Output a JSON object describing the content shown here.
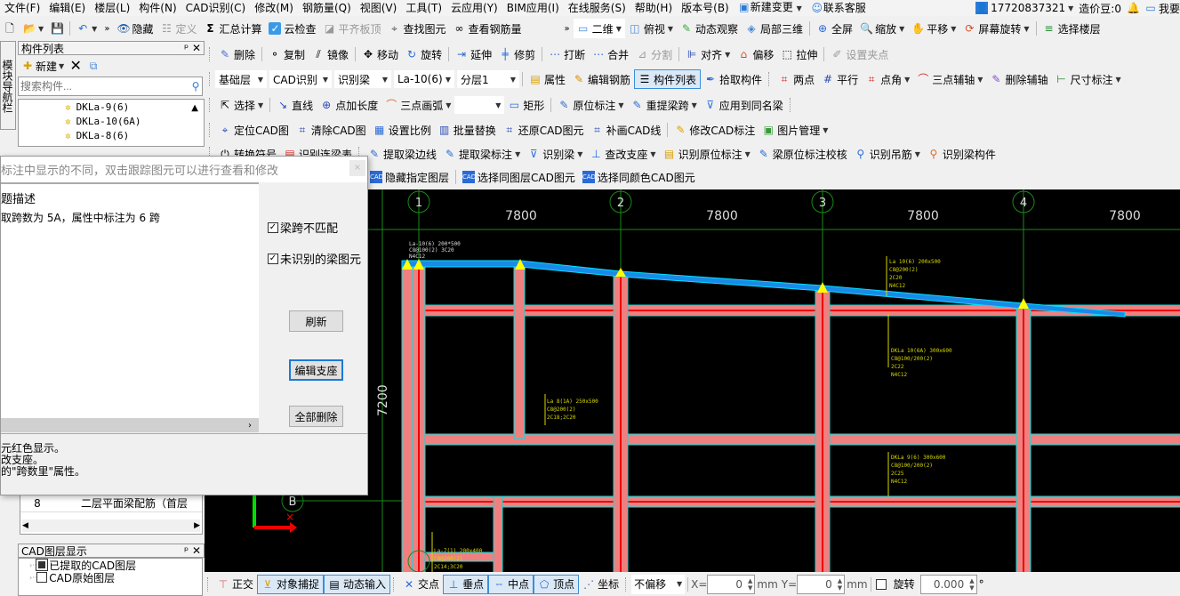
{
  "menu": {
    "items": [
      "文件(F)",
      "编辑(E)",
      "楼层(L)",
      "构件(N)",
      "CAD识别(C)",
      "修改(M)",
      "钢筋量(Q)",
      "视图(V)",
      "工具(T)",
      "云应用(Y)",
      "BIM应用(I)",
      "在线服务(S)",
      "帮助(H)",
      "版本号(B)"
    ],
    "new_change": "新建变更",
    "contact": "联系客服",
    "account": "17720837321",
    "beans": "造价豆:0",
    "find_me": "我要"
  },
  "toolbar1": {
    "hide": "隐藏",
    "define": "定义",
    "calc": "汇总计算",
    "cloud_check": "云检查",
    "level_slab": "平齐板顶",
    "find_elem": "查找图元",
    "view_rebar": "查看钢筋量",
    "view2d": "二维",
    "top_view": "俯视",
    "dyn_view": "动态观察",
    "local3d": "局部三维",
    "fullscreen": "全屏",
    "zoom": "缩放",
    "pan": "平移",
    "rotate_screen": "屏幕旋转",
    "select_floor": "选择楼层"
  },
  "left_panel": {
    "title": "构件列表",
    "new": "新建",
    "search_placeholder": "搜索构件...",
    "side_tab": "模块导航栏",
    "items": [
      "DKLa-9(6)",
      "DKLa-10(6A)",
      "DKLa-8(6)"
    ]
  },
  "toolbar2": {
    "delete": "删除",
    "copy": "复制",
    "mirror": "镜像",
    "move": "移动",
    "rotate": "旋转",
    "extend": "延伸",
    "trim": "修剪",
    "break": "打断",
    "merge": "合并",
    "split": "分割",
    "align": "对齐",
    "offset": "偏移",
    "stretch": "拉伸",
    "set_grip": "设置夹点"
  },
  "toolbar3": {
    "floor": "基础层",
    "mode": "CAD识别",
    "type": "识别梁",
    "component": "La-10(6)",
    "layer": "分层1",
    "property": "属性",
    "edit_rebar": "编辑钢筋",
    "comp_list": "构件列表",
    "pick": "拾取构件",
    "two_point": "两点",
    "parallel": "平行",
    "point_angle": "点角",
    "three_axis": "三点辅轴",
    "del_axis": "删除辅轴",
    "dimension": "尺寸标注"
  },
  "toolbar4": {
    "select": "选择",
    "line": "直线",
    "point_len": "点加长度",
    "arc": "三点画弧",
    "rect": "矩形",
    "orig_mark": "原位标注",
    "redo_span": "重提梁跨",
    "apply_same": "应用到同名梁"
  },
  "toolbar5": {
    "locate": "定位CAD图",
    "clear": "清除CAD图",
    "scale": "设置比例",
    "batch": "批量替换",
    "restore": "还原CAD图元",
    "supplement": "补画CAD线",
    "modify_mark": "修改CAD标注",
    "image_mgr": "图片管理"
  },
  "toolbar6": {
    "convert": "转换符号",
    "recognize_table": "识别连梁表",
    "extract_edge": "提取梁边线",
    "extract_mark": "提取梁标注",
    "recog_beam": "识别梁",
    "modify_support": "查改支座",
    "recog_orig": "识别原位标注",
    "check_orig": "梁原位标注校核",
    "recog_hanger": "识别吊筋",
    "recog_comp": "识别梁构件"
  },
  "toolbar7": {
    "hide_layer": "隐藏指定图层",
    "select_same_layer": "选择同图层CAD图元",
    "select_same_color": "选择同颜色CAD图元"
  },
  "dialog": {
    "hint": "标注中显示的不同，双击跟踪图元可以进行查看和修改",
    "col_header": "题描述",
    "row1": "取跨数为 5A，属性中标注为 6 跨",
    "cb1": "梁跨不匹配",
    "cb2": "未识别的梁图元",
    "cb1_checked": true,
    "cb2_checked": true,
    "refresh": "刷新",
    "edit_support": "编辑支座",
    "delete_all": "全部删除",
    "notes": [
      "元红色显示。",
      "改支座。",
      "的\"跨数里\"属性。"
    ]
  },
  "left_lower": {
    "row_num": "8",
    "row_text": "二层平面梁配筋（首层",
    "cad_layer_title": "CAD图层显示",
    "layers": [
      "已提取的CAD图层",
      "CAD原始图层"
    ]
  },
  "cad": {
    "axes": [
      "1",
      "2",
      "3",
      "4"
    ],
    "spans": [
      "7800",
      "7800",
      "7800",
      "7800"
    ],
    "row_axis": "B",
    "dim_side": "7200",
    "annotations": [
      "La-10(6) 200*500",
      "C8@100(2) 3C20",
      "N4C12",
      "La 10(6) 200x500",
      "C8@200(2)",
      "2C20",
      "N4C12",
      "DKLa 10(6A) 300x600",
      "C8@100/200(2)",
      "2C22",
      "N4C12",
      "DKLa 9(6) 300x600",
      "C8@100/200(2)",
      "2C25",
      "N4C12",
      "La 8(1A) 250x500",
      "C8@200(2)",
      "2C18;2C20",
      "La-7(1) 200x400",
      "C8@200(2)",
      "2C14;3C20"
    ]
  },
  "status": {
    "ortho": "正交",
    "snap": "对象捕捉",
    "dyn_input": "动态输入",
    "intersect": "交点",
    "perp": "垂点",
    "mid": "中点",
    "vertex": "顶点",
    "coord": "坐标",
    "offset_mode": "不偏移",
    "x_label": "X=",
    "x_val": "0",
    "y_label": "Y=",
    "y_val": "0",
    "unit": "mm",
    "rotate": "旋转",
    "rot_val": "0.000",
    "deg": "°"
  }
}
